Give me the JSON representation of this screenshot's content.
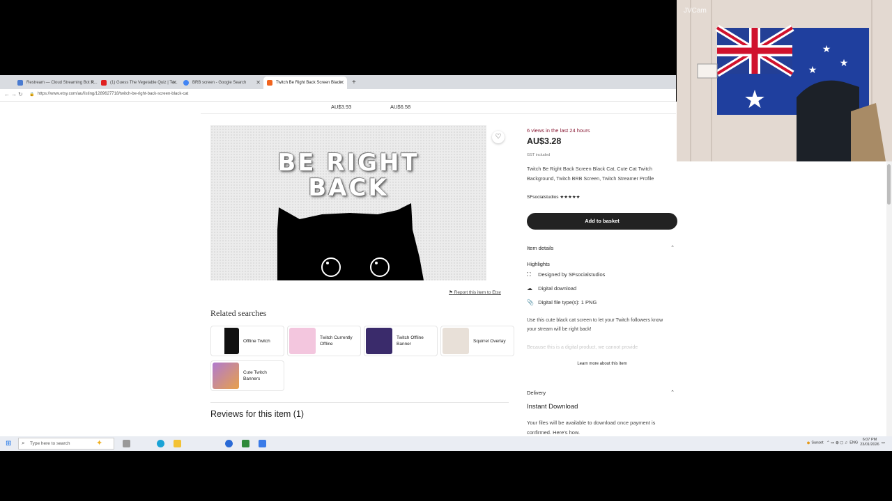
{
  "browser": {
    "tabs": [
      {
        "label": "Restream — Cloud Streaming Bot R...",
        "color": "#4a7bd0"
      },
      {
        "label": "(1) Guess The Vegetable Quiz | Te...",
        "color": "#e02020"
      },
      {
        "label": "BRB screen - Google Search",
        "color": "#4285f4"
      },
      {
        "label": "Twitch Be Right Back Screen Black",
        "color": "#f1641e"
      }
    ],
    "new_tab": "+",
    "url": "https://www.etsy.com/au/listing/1289627718/twitch-be-right-back-screen-black-cat"
  },
  "top_prices": [
    "AU$3.93",
    "AU$6.58"
  ],
  "image": {
    "line1": "BE RIGHT",
    "line2": "BACK"
  },
  "report_link": "Report this item to Etsy",
  "related": {
    "title": "Related searches",
    "items": [
      {
        "label": "Offline Twitch",
        "color": "#111"
      },
      {
        "label": "Twitch Currently Offline",
        "color": "#f0c8e0"
      },
      {
        "label": "Twitch Offline Banner",
        "color": "#3a2b6b"
      },
      {
        "label": "Squirrel Overlay",
        "color": "#e8e0d8"
      },
      {
        "label": "Cute Twitch Banners",
        "color": "#b07ad0"
      }
    ]
  },
  "reviews_title": "Reviews for this item (1)",
  "product": {
    "views": "6 views in the last 24 hours",
    "price": "AU$3.28",
    "tax": "GST included",
    "title": "Twitch Be Right Back Screen Black Cat, Cute Cat Twitch Background, Twitch BRB Screen, Twitch Streamer Profile",
    "shop": "SFsocialstudios",
    "stars": "★★★★★",
    "basket": "Add to basket",
    "item_details": "Item details",
    "highlights": "Highlights",
    "hl_items": [
      {
        "icon": "⛶",
        "text": "Designed by SFsocialstudios"
      },
      {
        "icon": "☁",
        "text": "Digital download"
      },
      {
        "icon": "📎",
        "text": "Digital file type(s): 1 PNG"
      }
    ],
    "description": "Use this cute black cat screen to let your Twitch followers know your stream will be right back!",
    "description_fade": "Because this is a digital product, we cannot provide",
    "learn_more": "Learn more about this item",
    "delivery": "Delivery",
    "instant": "Instant Download",
    "delivery_text": "Your files will be available to download once payment is confirmed. Here's how."
  },
  "cam": {
    "label": "JVCam"
  },
  "taskbar": {
    "search_placeholder": "Type here to search",
    "weather": "Sunset",
    "lang": "ENG",
    "time": "6:07 PM",
    "date": "23/01/2026"
  }
}
